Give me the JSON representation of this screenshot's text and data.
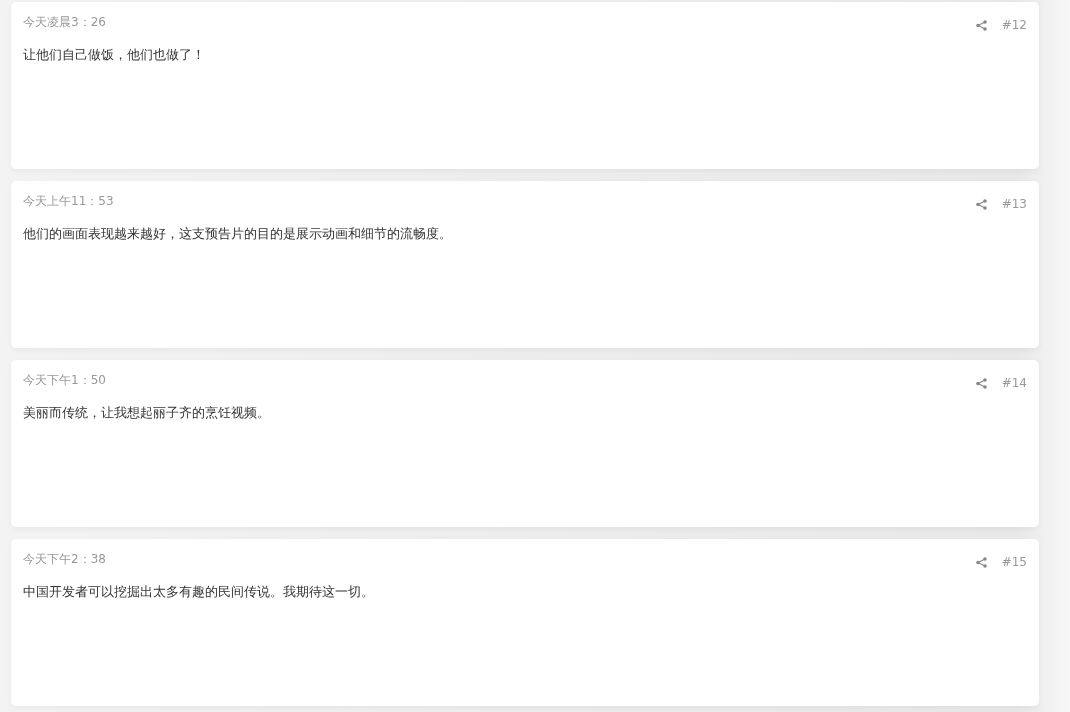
{
  "comments": [
    {
      "time": "今天凌晨3：26",
      "text": "让他们自己做饭，他们也做了！",
      "number": "#12"
    },
    {
      "time": "今天上午11：53",
      "text": "他们的画面表现越来越好，这支预告片的目的是展示动画和细节的流畅度。",
      "number": "#13"
    },
    {
      "time": "今天下午1：50",
      "text": "美丽而传统，让我想起丽子齐的烹饪视频。",
      "number": "#14"
    },
    {
      "time": "今天下午2：38",
      "text": "中国开发者可以挖掘出太多有趣的民间传说。我期待这一切。",
      "number": "#15"
    }
  ]
}
